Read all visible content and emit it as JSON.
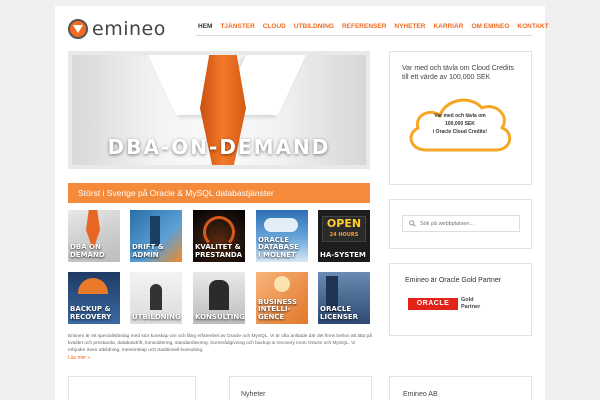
{
  "brand": {
    "name": "emineo",
    "accent": "#f26b21"
  },
  "nav": {
    "items": [
      "HEM",
      "TJÄNSTER",
      "CLOUD",
      "UTBILDNING",
      "REFERENSER",
      "NYHETER",
      "KARRIÄR",
      "OM EMINEO",
      "KONTAKT"
    ],
    "active": "HEM"
  },
  "hero": {
    "text": "DBA-ON-DEMAND"
  },
  "banner": {
    "text": "Störst i Sverige på Oracle & MySQL databastjänster"
  },
  "tiles": [
    {
      "label": "DBA ON\nDEMAND",
      "icon": "tie-photo"
    },
    {
      "label": "DRIFT &\nADMIN",
      "icon": "server-photo"
    },
    {
      "label": "KVALITET &\nPRESTANDA",
      "icon": "speedometer-photo"
    },
    {
      "label": "ORACLE\nDATABASE\nI MOLNET",
      "icon": "cloud-photo"
    },
    {
      "label": "HA-SYSTEM",
      "icon": "open-24-hours-sign"
    },
    {
      "label": "BACKUP &\nRECOVERY",
      "icon": "umbrella-photo"
    },
    {
      "label": "UTBILDNING",
      "icon": "graduate-photo"
    },
    {
      "label": "KONSULTING",
      "icon": "businessman-photo"
    },
    {
      "label": "BUSINESS\nINTELLI-\nGENCE",
      "icon": "lightbulb-photo"
    },
    {
      "label": "ORACLE\nLICENSER",
      "icon": "skyscraper-photo"
    }
  ],
  "intro": {
    "text": "Emineo är ett specialistbolag med stor kunskap om och lång erfarenhet av Oracle och MySQL. Vi är ofta anlitade där det finns behov att titta på kvalitet och prestanda, databasdrift, konsoldering, standardisering, licensrådgivning och backup & recovery inom Oracle och MySQL. Vi erbjuder även utbildning, mentorskap och traditionell konsulting.",
    "read_more": "Läs mer »"
  },
  "sidebar": {
    "cloud": {
      "text": "Var med och tävla om Cloud Credits till ett värde av 100,000 SEK",
      "badge_line1": "Var med och tävla om",
      "badge_line2": "100,000 SEK",
      "badge_line3": "i Oracle Cloud Credits!"
    },
    "search": {
      "placeholder": "Sök på webbplatsen..."
    },
    "partner": {
      "title": "Emineo är Oracle Gold Partner",
      "logo_text": "ORACLE",
      "level": "Gold\nPartner"
    }
  },
  "bottom": {
    "news_title": "Nyheter",
    "company_title": "Emineo AB"
  }
}
